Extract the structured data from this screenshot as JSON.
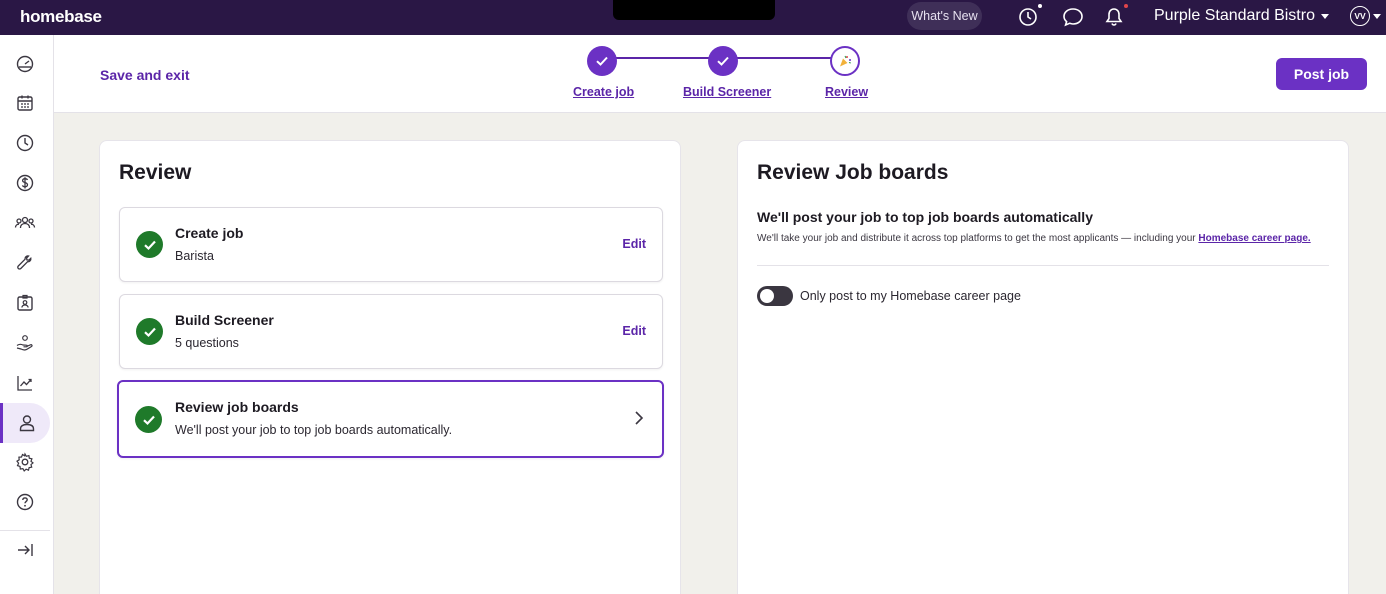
{
  "brand": {
    "logo": "homebase"
  },
  "topbar": {
    "whats_new": "What's New",
    "business_name": "Purple Standard Bistro",
    "avatar_initials": "VV"
  },
  "header": {
    "save_exit": "Save and exit",
    "post_job": "Post job",
    "steps": [
      {
        "label": "Create job",
        "status": "done"
      },
      {
        "label": "Build Screener",
        "status": "done"
      },
      {
        "label": "Review",
        "status": "current"
      }
    ]
  },
  "review": {
    "title": "Review",
    "items": [
      {
        "title": "Create job",
        "subtitle": "Barista",
        "action": "Edit"
      },
      {
        "title": "Build Screener",
        "subtitle": "5 questions",
        "action": "Edit"
      },
      {
        "title": "Review job boards",
        "subtitle": "We'll post your job to top job boards automatically."
      }
    ]
  },
  "job_boards": {
    "title": "Review Job boards",
    "subtitle": "We'll post your job to top job boards automatically",
    "description": "We'll take your job and distribute it across top platforms to get the most applicants — including your",
    "link": "Homebase career page.",
    "toggle_label": "Only post to my Homebase career page",
    "toggle_on": false
  },
  "colors": {
    "brand_purple": "#6b31c4",
    "topbar_bg": "#2a1745",
    "success_green": "#1f7a2a"
  }
}
